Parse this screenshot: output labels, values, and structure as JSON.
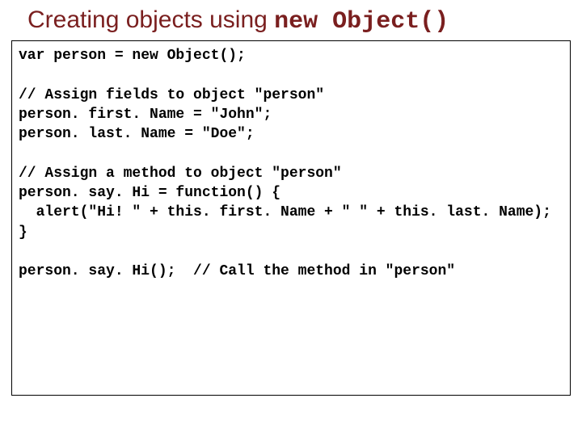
{
  "title": {
    "prefix": "Creating objects using ",
    "mono": "new Object()"
  },
  "code": {
    "l1": "var person = new Object();",
    "blank1": "",
    "l2": "// Assign fields to object \"person\"",
    "l3": "person. first. Name = \"John\";",
    "l4": "person. last. Name = \"Doe\";",
    "blank2": "",
    "l5": "// Assign a method to object \"person\"",
    "l6": "person. say. Hi = function() {",
    "l7": "  alert(\"Hi! \" + this. first. Name + \" \" + this. last. Name);",
    "l8": "}",
    "blank3": "",
    "l9": "person. say. Hi();  // Call the method in \"person\""
  }
}
